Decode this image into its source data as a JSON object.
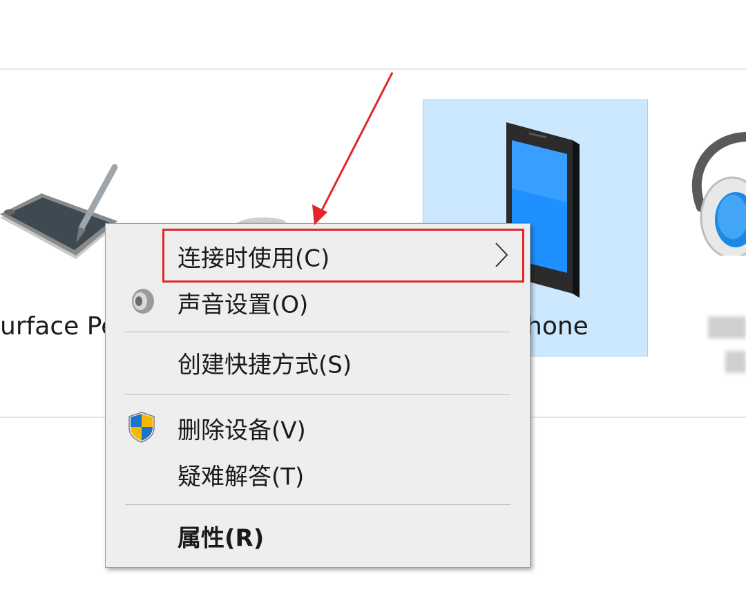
{
  "devices": [
    {
      "name": "urface Pe",
      "icon": "pen-tablet-icon"
    },
    {
      "name": "hone",
      "icon": "phone-icon",
      "selected": true
    },
    {
      "name": "",
      "icon": "headset-icon"
    }
  ],
  "context_menu": {
    "items": [
      {
        "label": "连接时使用(C)",
        "has_submenu": true,
        "highlighted": true
      },
      {
        "label": "声音设置(O)",
        "icon": "speaker-icon"
      },
      {
        "label": "创建快捷方式(S)"
      },
      {
        "label": "删除设备(V)",
        "icon": "uac-shield-icon"
      },
      {
        "label": "疑难解答(T)"
      },
      {
        "label": "属性(R)",
        "bold": true
      }
    ]
  },
  "colors": {
    "selection_bg": "#cce8ff",
    "selection_border": "#99d1ff",
    "annotation_red": "#e0262a",
    "menu_bg": "#eeeeee"
  }
}
